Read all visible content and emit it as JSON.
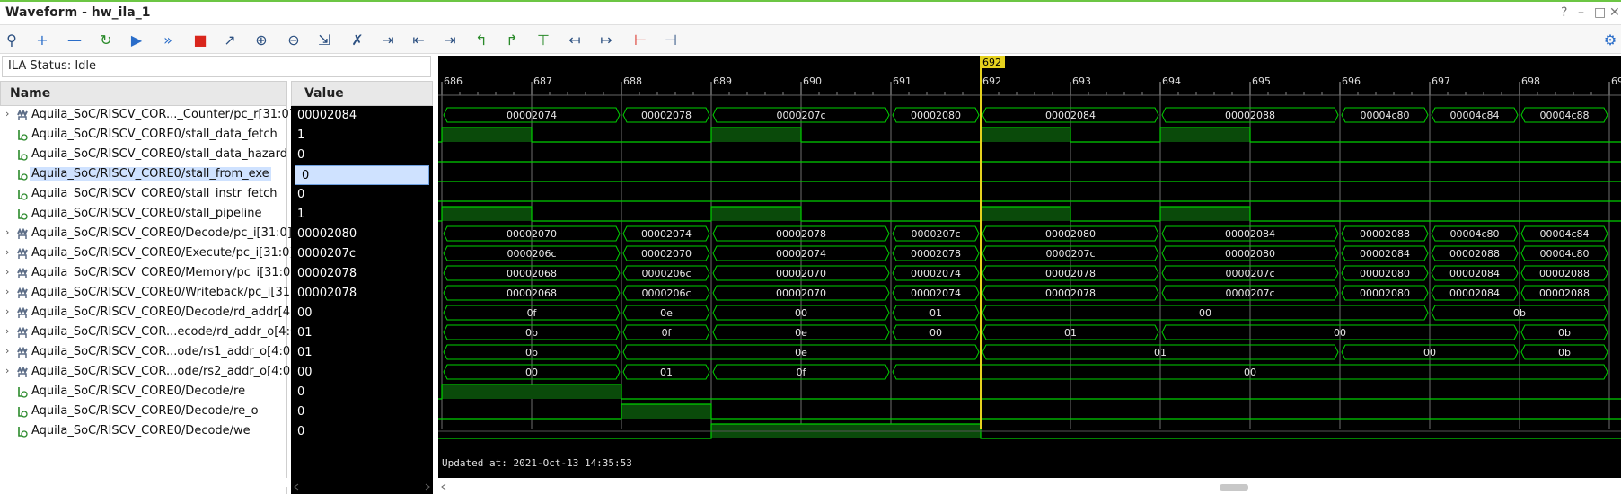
{
  "window": {
    "title": "Waveform - hw_ila_1"
  },
  "status": {
    "text": "ILA Status: Idle"
  },
  "columns": {
    "name": "Name",
    "value": "Value"
  },
  "cursor": {
    "label": "692",
    "time": 692
  },
  "time_axis": {
    "start": 686,
    "end": 699,
    "ticks": [
      "686",
      "687",
      "688",
      "689",
      "690",
      "691",
      "692",
      "693",
      "694",
      "695",
      "696",
      "697",
      "698",
      "69"
    ]
  },
  "updated": "Updated at:  2021-Oct-13 14:35:53",
  "signals": [
    {
      "name": "Aquila_SoC/RISCV_COR..._Counter/pc_r[31:0]",
      "value": "00002084",
      "bus": true,
      "segments": [
        {
          "start": 686,
          "end": 688,
          "label": "00002074"
        },
        {
          "start": 688,
          "end": 689,
          "label": "00002078"
        },
        {
          "start": 689,
          "end": 691,
          "label": "0000207c"
        },
        {
          "start": 691,
          "end": 692,
          "label": "00002080"
        },
        {
          "start": 692,
          "end": 694,
          "label": "00002084"
        },
        {
          "start": 694,
          "end": 696,
          "label": "00002088"
        },
        {
          "start": 696,
          "end": 697,
          "label": "00004c80"
        },
        {
          "start": 697,
          "end": 698,
          "label": "00004c84"
        },
        {
          "start": 698,
          "end": 699,
          "label": "00004c88"
        }
      ]
    },
    {
      "name": "Aquila_SoC/RISCV_CORE0/stall_data_fetch",
      "value": "1",
      "bus": false,
      "high": [
        [
          686,
          687
        ],
        [
          689,
          690
        ],
        [
          692,
          693
        ],
        [
          694,
          695
        ]
      ]
    },
    {
      "name": "Aquila_SoC/RISCV_CORE0/stall_data_hazard",
      "value": "0",
      "bus": false,
      "high": []
    },
    {
      "name": "Aquila_SoC/RISCV_CORE0/stall_from_exe",
      "value": "0",
      "bus": false,
      "high": [],
      "selected": true
    },
    {
      "name": "Aquila_SoC/RISCV_CORE0/stall_instr_fetch",
      "value": "0",
      "bus": false,
      "high": []
    },
    {
      "name": "Aquila_SoC/RISCV_CORE0/stall_pipeline",
      "value": "1",
      "bus": false,
      "high": [
        [
          686,
          687
        ],
        [
          689,
          690
        ],
        [
          692,
          693
        ],
        [
          694,
          695
        ]
      ]
    },
    {
      "name": "Aquila_SoC/RISCV_CORE0/Decode/pc_i[31:0]",
      "value": "00002080",
      "bus": true,
      "segments": [
        {
          "start": 686,
          "end": 688,
          "label": "00002070"
        },
        {
          "start": 688,
          "end": 689,
          "label": "00002074"
        },
        {
          "start": 689,
          "end": 691,
          "label": "00002078"
        },
        {
          "start": 691,
          "end": 692,
          "label": "0000207c"
        },
        {
          "start": 692,
          "end": 694,
          "label": "00002080"
        },
        {
          "start": 694,
          "end": 696,
          "label": "00002084"
        },
        {
          "start": 696,
          "end": 697,
          "label": "00002088"
        },
        {
          "start": 697,
          "end": 698,
          "label": "00004c80"
        },
        {
          "start": 698,
          "end": 699,
          "label": "00004c84"
        }
      ]
    },
    {
      "name": "Aquila_SoC/RISCV_CORE0/Execute/pc_i[31:0]",
      "value": "0000207c",
      "bus": true,
      "segments": [
        {
          "start": 686,
          "end": 688,
          "label": "0000206c"
        },
        {
          "start": 688,
          "end": 689,
          "label": "00002070"
        },
        {
          "start": 689,
          "end": 691,
          "label": "00002074"
        },
        {
          "start": 691,
          "end": 692,
          "label": "00002078"
        },
        {
          "start": 692,
          "end": 694,
          "label": "0000207c"
        },
        {
          "start": 694,
          "end": 696,
          "label": "00002080"
        },
        {
          "start": 696,
          "end": 697,
          "label": "00002084"
        },
        {
          "start": 697,
          "end": 698,
          "label": "00002088"
        },
        {
          "start": 698,
          "end": 699,
          "label": "00004c80"
        }
      ]
    },
    {
      "name": "Aquila_SoC/RISCV_CORE0/Memory/pc_i[31:0]",
      "value": "00002078",
      "bus": true,
      "segments": [
        {
          "start": 686,
          "end": 688,
          "label": "00002068"
        },
        {
          "start": 688,
          "end": 689,
          "label": "0000206c"
        },
        {
          "start": 689,
          "end": 691,
          "label": "00002070"
        },
        {
          "start": 691,
          "end": 692,
          "label": "00002074"
        },
        {
          "start": 692,
          "end": 694,
          "label": "00002078"
        },
        {
          "start": 694,
          "end": 696,
          "label": "0000207c"
        },
        {
          "start": 696,
          "end": 697,
          "label": "00002080"
        },
        {
          "start": 697,
          "end": 698,
          "label": "00002084"
        },
        {
          "start": 698,
          "end": 699,
          "label": "00002088"
        }
      ]
    },
    {
      "name": "Aquila_SoC/RISCV_CORE0/Writeback/pc_i[31:0]",
      "value": "00002078",
      "bus": true,
      "segments": [
        {
          "start": 686,
          "end": 688,
          "label": "00002068"
        },
        {
          "start": 688,
          "end": 689,
          "label": "0000206c"
        },
        {
          "start": 689,
          "end": 691,
          "label": "00002070"
        },
        {
          "start": 691,
          "end": 692,
          "label": "00002074"
        },
        {
          "start": 692,
          "end": 694,
          "label": "00002078"
        },
        {
          "start": 694,
          "end": 696,
          "label": "0000207c"
        },
        {
          "start": 696,
          "end": 697,
          "label": "00002080"
        },
        {
          "start": 697,
          "end": 698,
          "label": "00002084"
        },
        {
          "start": 698,
          "end": 699,
          "label": "00002088"
        }
      ]
    },
    {
      "name": "Aquila_SoC/RISCV_CORE0/Decode/rd_addr[4:0]",
      "value": "00",
      "bus": true,
      "segments": [
        {
          "start": 686,
          "end": 688,
          "label": "0f"
        },
        {
          "start": 688,
          "end": 689,
          "label": "0e"
        },
        {
          "start": 689,
          "end": 691,
          "label": "00"
        },
        {
          "start": 691,
          "end": 692,
          "label": "01"
        },
        {
          "start": 692,
          "end": 697,
          "label": "00"
        },
        {
          "start": 697,
          "end": 699,
          "label": "0b"
        }
      ]
    },
    {
      "name": "Aquila_SoC/RISCV_COR...ecode/rd_addr_o[4:0]",
      "value": "01",
      "bus": true,
      "segments": [
        {
          "start": 686,
          "end": 688,
          "label": "0b"
        },
        {
          "start": 688,
          "end": 689,
          "label": "0f"
        },
        {
          "start": 689,
          "end": 691,
          "label": "0e"
        },
        {
          "start": 691,
          "end": 692,
          "label": "00"
        },
        {
          "start": 692,
          "end": 694,
          "label": "01"
        },
        {
          "start": 694,
          "end": 698,
          "label": "00"
        },
        {
          "start": 698,
          "end": 699,
          "label": "0b"
        }
      ]
    },
    {
      "name": "Aquila_SoC/RISCV_COR...ode/rs1_addr_o[4:0]",
      "value": "01",
      "bus": true,
      "segments": [
        {
          "start": 686,
          "end": 688,
          "label": "0b"
        },
        {
          "start": 688,
          "end": 692,
          "label": "0e"
        },
        {
          "start": 692,
          "end": 696,
          "label": "01"
        },
        {
          "start": 696,
          "end": 698,
          "label": "00"
        },
        {
          "start": 698,
          "end": 699,
          "label": "0b"
        }
      ]
    },
    {
      "name": "Aquila_SoC/RISCV_COR...ode/rs2_addr_o[4:0]",
      "value": "00",
      "bus": true,
      "segments": [
        {
          "start": 686,
          "end": 688,
          "label": "00"
        },
        {
          "start": 688,
          "end": 689,
          "label": "01"
        },
        {
          "start": 689,
          "end": 691,
          "label": "0f"
        },
        {
          "start": 691,
          "end": 699,
          "label": "00"
        }
      ]
    },
    {
      "name": "Aquila_SoC/RISCV_CORE0/Decode/re",
      "value": "0",
      "bus": false,
      "high": [
        [
          686,
          688
        ]
      ]
    },
    {
      "name": "Aquila_SoC/RISCV_CORE0/Decode/re_o",
      "value": "0",
      "bus": false,
      "high": [
        [
          688,
          689
        ]
      ]
    },
    {
      "name": "Aquila_SoC/RISCV_CORE0/Decode/we",
      "value": "0",
      "bus": false,
      "high": [
        [
          689,
          692
        ]
      ]
    }
  ],
  "toolbar": [
    "search-icon",
    "zoom-add-icon",
    "remove-icon",
    "refresh-icon",
    "run-icon",
    "run-fast-icon",
    "stop-icon",
    "export-icon",
    "zoom-in-icon",
    "zoom-out-icon",
    "zoom-fit-icon",
    "cursor-icon",
    "marker-icon",
    "go-first-icon",
    "go-last-icon",
    "prev-edge-icon",
    "next-edge-icon",
    "add-marker-icon",
    "prev-marker-icon",
    "next-marker-icon",
    "swap-icon",
    "delete-marker-icon",
    "settings-icon"
  ],
  "colors": {
    "wave": "#00d000",
    "fill": "#0a4a0a",
    "grid": "#6e6e6e",
    "cursor": "#e6d21e",
    "select": "#cfe2ff"
  }
}
